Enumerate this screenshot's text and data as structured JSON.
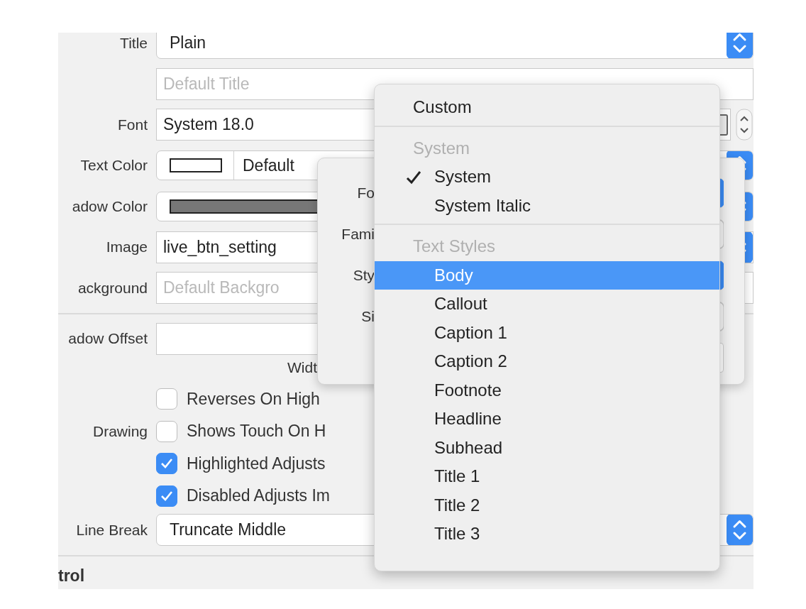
{
  "inspector": {
    "rows": [
      {
        "kind": "popup",
        "label": "Title",
        "value": "Plain"
      },
      {
        "kind": "text",
        "placeholder": "Default Title"
      },
      {
        "kind": "font",
        "label": "Font",
        "value": "System 18.0"
      },
      {
        "kind": "color",
        "label": "Text Color",
        "color": "#ffffff",
        "value": "Default"
      },
      {
        "kind": "color",
        "label": "adow Color",
        "color": "#777777"
      },
      {
        "kind": "combo",
        "label": "Image",
        "value": "live_btn_setting"
      },
      {
        "kind": "text",
        "label": "ackground",
        "placeholder": "Default Backgro"
      },
      {
        "kind": "divider"
      },
      {
        "kind": "offset",
        "label": "adow Offset",
        "caption": "Widt"
      },
      {
        "kind": "checkbox",
        "text": "Reverses On High",
        "checked": false
      },
      {
        "kind": "checkbox",
        "label": "Drawing",
        "text": "Shows Touch On H",
        "checked": false
      },
      {
        "kind": "checkbox",
        "text": "Highlighted Adjusts",
        "checked": true
      },
      {
        "kind": "checkbox",
        "text": "Disabled Adjusts Im",
        "checked": true
      },
      {
        "kind": "popup",
        "label": "Line Break",
        "value": "Truncate Middle"
      },
      {
        "kind": "divider"
      },
      {
        "kind": "section",
        "label": "trol"
      }
    ]
  },
  "font_popover": {
    "rows": [
      {
        "kind": "popup",
        "label": "Fo"
      },
      {
        "kind": "select",
        "label": "Fami"
      },
      {
        "kind": "popup",
        "label": "Sty"
      },
      {
        "kind": "stepper",
        "label": "Si"
      },
      {
        "kind": "field"
      }
    ]
  },
  "font_menu": {
    "items": [
      {
        "kind": "item",
        "label": "Custom",
        "checked": false,
        "selected": false
      },
      {
        "kind": "separator"
      },
      {
        "kind": "header",
        "label": "System"
      },
      {
        "kind": "item",
        "label": "System",
        "checked": true,
        "selected": false
      },
      {
        "kind": "item",
        "label": "System Italic",
        "checked": false,
        "selected": false
      },
      {
        "kind": "separator"
      },
      {
        "kind": "header",
        "label": "Text Styles"
      },
      {
        "kind": "item",
        "label": "Body",
        "checked": false,
        "selected": true
      },
      {
        "kind": "item",
        "label": "Callout",
        "checked": false,
        "selected": false
      },
      {
        "kind": "item",
        "label": "Caption 1",
        "checked": false,
        "selected": false
      },
      {
        "kind": "item",
        "label": "Caption 2",
        "checked": false,
        "selected": false
      },
      {
        "kind": "item",
        "label": "Footnote",
        "checked": false,
        "selected": false
      },
      {
        "kind": "item",
        "label": "Headline",
        "checked": false,
        "selected": false
      },
      {
        "kind": "item",
        "label": "Subhead",
        "checked": false,
        "selected": false
      },
      {
        "kind": "item",
        "label": "Title 1",
        "checked": false,
        "selected": false
      },
      {
        "kind": "item",
        "label": "Title 2",
        "checked": false,
        "selected": false
      },
      {
        "kind": "item",
        "label": "Title 3",
        "checked": false,
        "selected": false
      }
    ]
  }
}
